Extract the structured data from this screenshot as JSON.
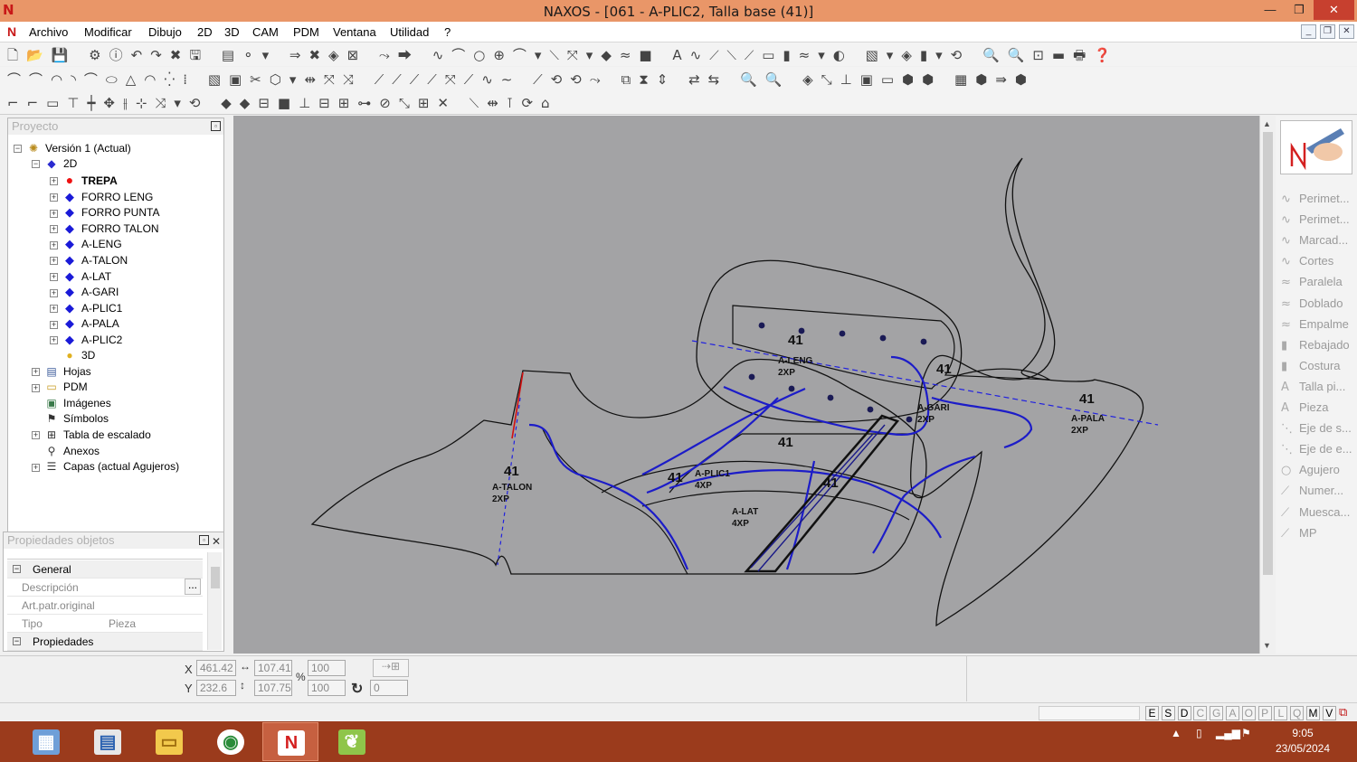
{
  "window": {
    "title": "NAXOS - [061 - A-PLIC2, Talla base (41)]",
    "controls": [
      "—",
      "❐",
      "✕"
    ]
  },
  "menu": {
    "items": [
      "Archivo",
      "Modificar",
      "Dibujo",
      "2D",
      "3D",
      "CAM",
      "PDM",
      "Ventana",
      "Utilidad",
      "?"
    ]
  },
  "project_panel": {
    "header": "Proyecto",
    "tree": {
      "root": "Versión 1 (Actual)",
      "node_2d": "2D",
      "pieces": [
        "TREPA",
        "FORRO LENG",
        "FORRO PUNTA",
        "FORRO TALON",
        "A-LENG",
        "A-TALON",
        "A-LAT",
        "A-GARI",
        "A-PLIC1",
        "A-PALA",
        "A-PLIC2"
      ],
      "others": [
        "3D",
        "Hojas",
        "PDM",
        "Imágenes",
        "Símbolos",
        "Tabla de escalado",
        "Anexos",
        "Capas (actual Agujeros)"
      ]
    }
  },
  "properties_panel": {
    "header": "Propiedades objetos",
    "group_general": "General",
    "rows": [
      {
        "key": "Descripción",
        "value": ""
      },
      {
        "key": "Art.patr.original",
        "value": ""
      },
      {
        "key": "Tipo",
        "value": "Pieza"
      }
    ],
    "group_props": "Propiedades",
    "ellipsis": "..."
  },
  "canvas": {
    "size_label": "41",
    "pieces": [
      {
        "name": "A-LENG",
        "qty": "2XP"
      },
      {
        "name": "A-GARI",
        "qty": "2XP"
      },
      {
        "name": "A-PALA",
        "qty": "2XP"
      },
      {
        "name": "A-TALON",
        "qty": "2XP"
      },
      {
        "name": "A-PLIC1",
        "qty": "4XP"
      },
      {
        "name": "A-LAT",
        "qty": "4XP"
      }
    ],
    "colors": {
      "background": "#a3a3a5",
      "outline": "#111111",
      "seam": "#1c1cc8",
      "axis": "#2020e0"
    }
  },
  "right_panel": {
    "items": [
      "Perimet...",
      "Perimet...",
      "Marcad...",
      "Cortes",
      "Paralela",
      "Doblado",
      "Empalme",
      "Rebajado",
      "Costura",
      "Talla pi...",
      "Pieza",
      "Eje de s...",
      "Eje de e...",
      "Agujero",
      "Numer...",
      "Muesca...",
      "MP"
    ]
  },
  "coords": {
    "x_label": "X",
    "y_label": "Y",
    "x": "461.42",
    "y": "232.6",
    "w": "107.41",
    "h": "107.75",
    "scale_x": "100",
    "scale_y": "100",
    "rotation": "0",
    "percent": "%"
  },
  "status": {
    "letters": [
      "E",
      "S",
      "D",
      "C",
      "G",
      "A",
      "O",
      "P",
      "L",
      "Q",
      "M",
      "V"
    ]
  },
  "taskbar": {
    "time": "9:05",
    "date": "23/05/2024"
  }
}
